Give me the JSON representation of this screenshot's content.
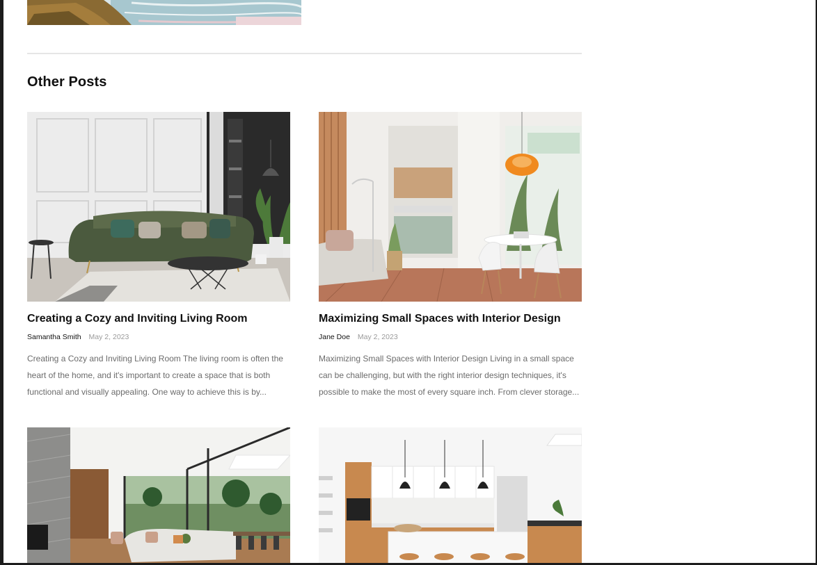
{
  "section": {
    "title": "Other Posts"
  },
  "posts": [
    {
      "title": "Creating a Cozy and Inviting Living Room",
      "author": "Samantha Smith",
      "date": "May 2, 2023",
      "excerpt": "Creating a Cozy and Inviting Living Room The living room is often the heart of the home, and it's important to create a space that is both functional and visually appealing. One way to achieve this is by..."
    },
    {
      "title": "Maximizing Small Spaces with Interior Design",
      "author": "Jane Doe",
      "date": "May 2, 2023",
      "excerpt": "Maximizing Small Spaces with Interior Design Living in a small space can be challenging, but with the right interior design techniques, it's possible to make the most of every square inch. From clever storage..."
    }
  ],
  "colors": {
    "page_bg": "#ffffff",
    "frame": "#1c1c1c",
    "title": "#111111",
    "muted": "#9a9a9a",
    "body_text": "#6b6b6b"
  }
}
